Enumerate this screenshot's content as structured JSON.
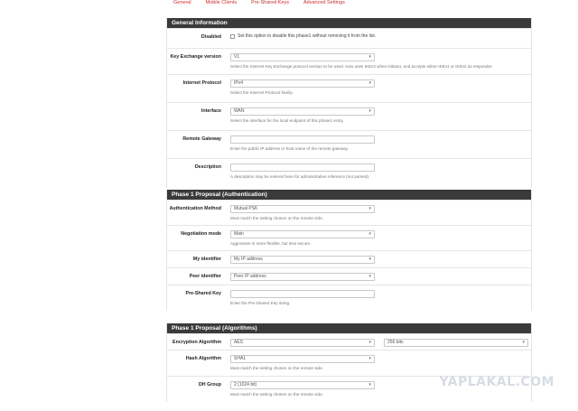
{
  "tabs": [
    "General",
    "Mobile Clients",
    "Pre-Shared Keys",
    "Advanced Settings"
  ],
  "general": {
    "heading": "General Information",
    "disabled_label": "Disabled",
    "disabled_text": "Set this option to disable this phase1 without removing it from the list.",
    "kex_label": "Key Exchange version",
    "kex_value": "V1",
    "kex_help": "Select the Internet Key Exchange protocol version to be used. Auto uses IKEv2 when initiator, and accepts either IKEv1 or IKEv2 as responder.",
    "ip_label": "Internet Protocol",
    "ip_value": "IPv4",
    "ip_help": "Select the Internet Protocol family.",
    "iface_label": "Interface",
    "iface_value": "WAN",
    "iface_help": "Select the interface for the local endpoint of this phase1 entry.",
    "gw_label": "Remote Gateway",
    "gw_value": "",
    "gw_help": "Enter the public IP address or host name of the remote gateway.",
    "desc_label": "Description",
    "desc_value": "",
    "desc_help": "A description may be entered here for administrative reference (not parsed)."
  },
  "auth": {
    "heading": "Phase 1 Proposal (Authentication)",
    "method_label": "Authentication Method",
    "method_value": "Mutual PSK",
    "method_help": "Must match the setting chosen on the remote side.",
    "neg_label": "Negotiation mode",
    "neg_value": "Main",
    "neg_help": "Aggressive is more flexible, but less secure.",
    "myid_label": "My identifier",
    "myid_value": "My IP address",
    "peerid_label": "Peer identifier",
    "peerid_value": "Peer IP address",
    "psk_label": "Pre-Shared Key",
    "psk_value": "",
    "psk_help": "Enter the Pre-Shared Key string."
  },
  "algo": {
    "heading": "Phase 1 Proposal (Algorithms)",
    "enc_label": "Encryption Algorithm",
    "enc_value": "AES",
    "enc_bits": "256 bits",
    "hash_label": "Hash Algorithm",
    "hash_value": "SHA1",
    "hash_help": "Must match the setting chosen on the remote side.",
    "dh_label": "DH Group",
    "dh_value": "2 (1024 bit)",
    "dh_help": "Must match the setting chosen on the remote side."
  },
  "watermark": "YAPLAKAL.COM"
}
